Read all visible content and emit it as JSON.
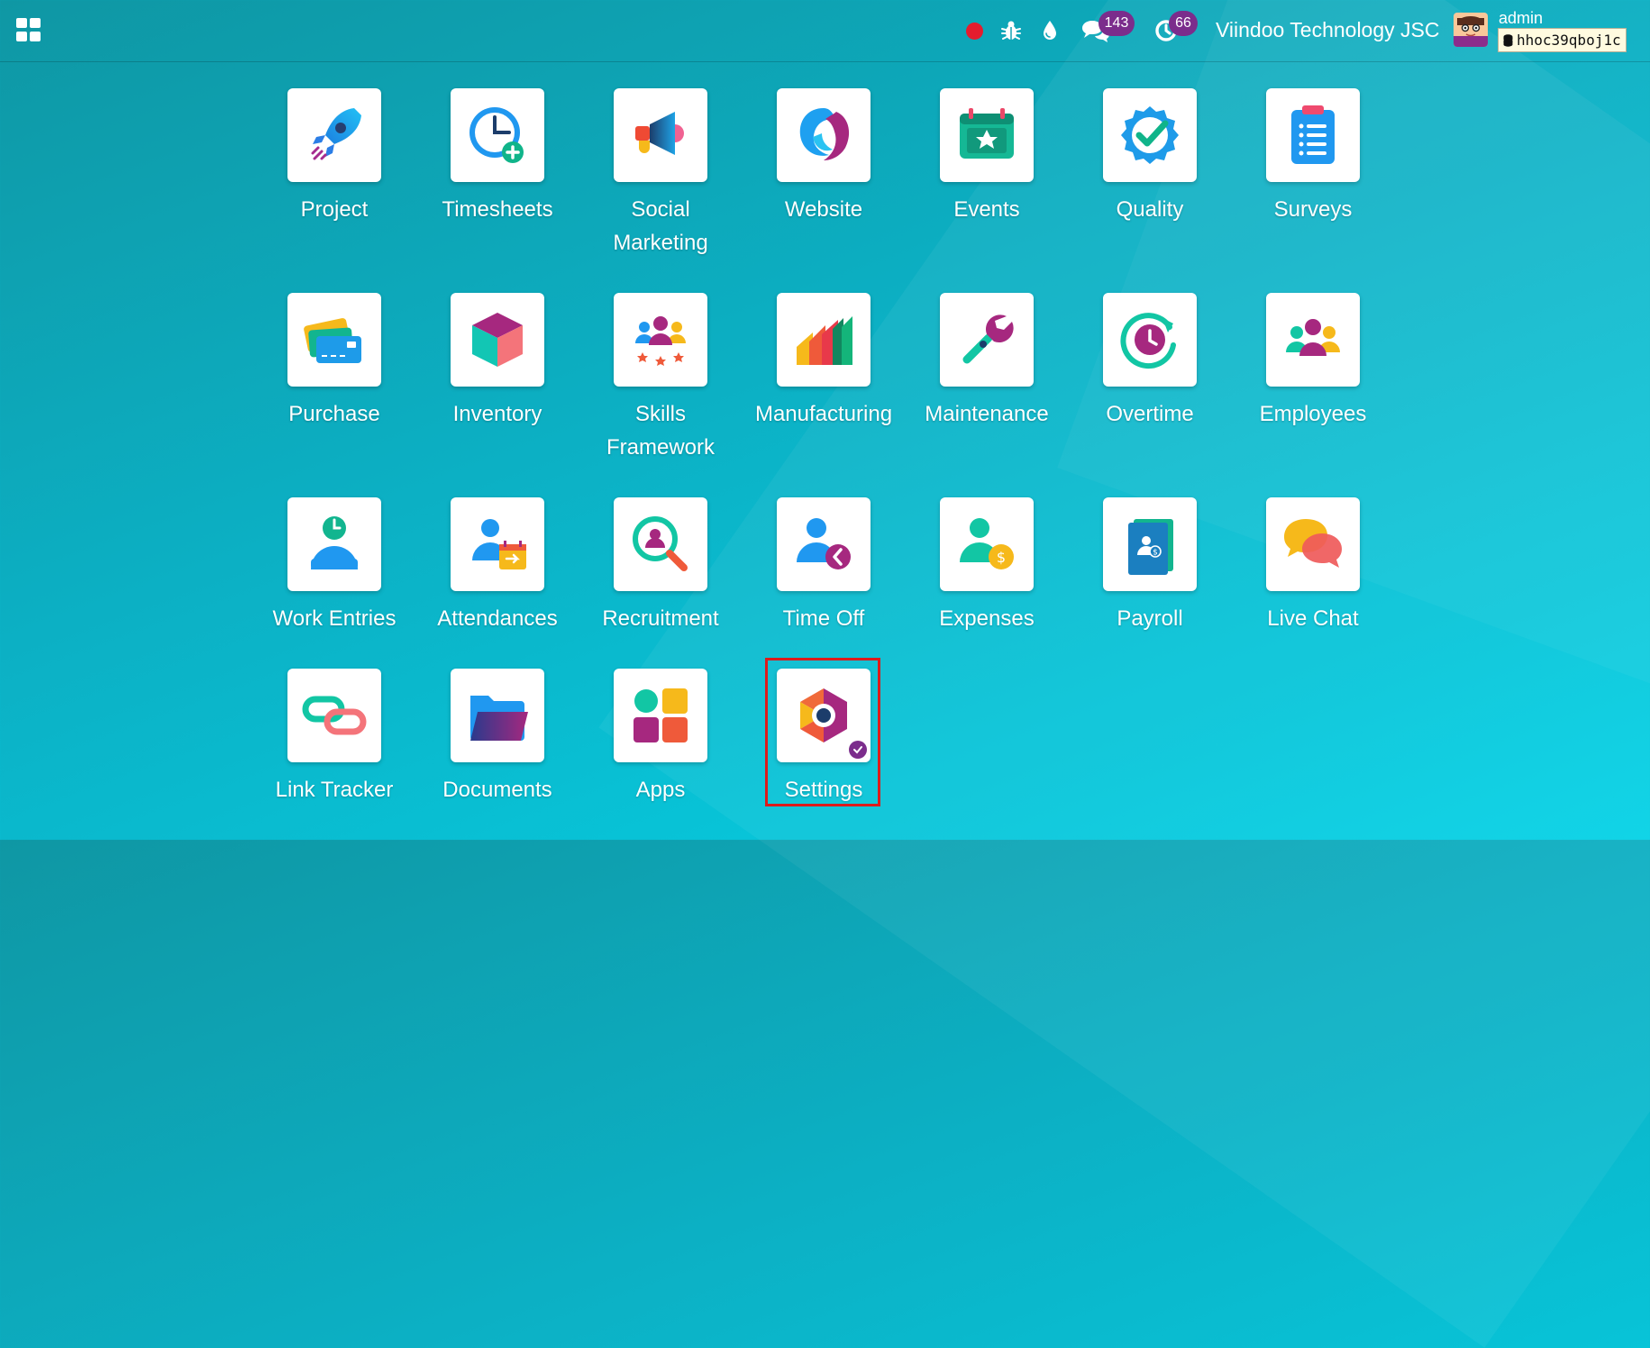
{
  "topbar": {
    "chat_count": "143",
    "activity_count": "66",
    "company_name": "Viindoo Technology JSC",
    "user_name": "admin",
    "database_name": "hhoc39qboj1c"
  },
  "apps": [
    {
      "label": "Project",
      "icon": "rocket-icon"
    },
    {
      "label": "Timesheets",
      "icon": "clock-plus-icon"
    },
    {
      "label": "Social Marketing",
      "icon": "megaphone-icon"
    },
    {
      "label": "Website",
      "icon": "website-logo-icon"
    },
    {
      "label": "Events",
      "icon": "calendar-star-icon"
    },
    {
      "label": "Quality",
      "icon": "badge-check-icon"
    },
    {
      "label": "Surveys",
      "icon": "clipboard-list-icon"
    },
    {
      "label": "Purchase",
      "icon": "credit-cards-icon"
    },
    {
      "label": "Inventory",
      "icon": "cube-icon"
    },
    {
      "label": "Skills Framework",
      "icon": "people-stars-icon"
    },
    {
      "label": "Manufacturing",
      "icon": "factory-icon"
    },
    {
      "label": "Maintenance",
      "icon": "wrench-icon"
    },
    {
      "label": "Overtime",
      "icon": "clock-cycle-icon"
    },
    {
      "label": "Employees",
      "icon": "people-group-icon"
    },
    {
      "label": "Work Entries",
      "icon": "person-clock-icon"
    },
    {
      "label": "Attendances",
      "icon": "person-calendar-icon"
    },
    {
      "label": "Recruitment",
      "icon": "person-magnifier-icon"
    },
    {
      "label": "Time Off",
      "icon": "person-back-icon"
    },
    {
      "label": "Expenses",
      "icon": "person-coin-icon"
    },
    {
      "label": "Payroll",
      "icon": "payslip-icon"
    },
    {
      "label": "Live Chat",
      "icon": "speech-bubbles-icon"
    },
    {
      "label": "Link Tracker",
      "icon": "chain-link-icon"
    },
    {
      "label": "Documents",
      "icon": "folder-icon"
    },
    {
      "label": "Apps",
      "icon": "app-squares-icon"
    },
    {
      "label": "Settings",
      "icon": "settings-hexagon-icon"
    }
  ],
  "colors": {
    "accent": "#7b2d8c",
    "recording": "#e51c2e",
    "highlight_border": "#dd1b1b"
  }
}
